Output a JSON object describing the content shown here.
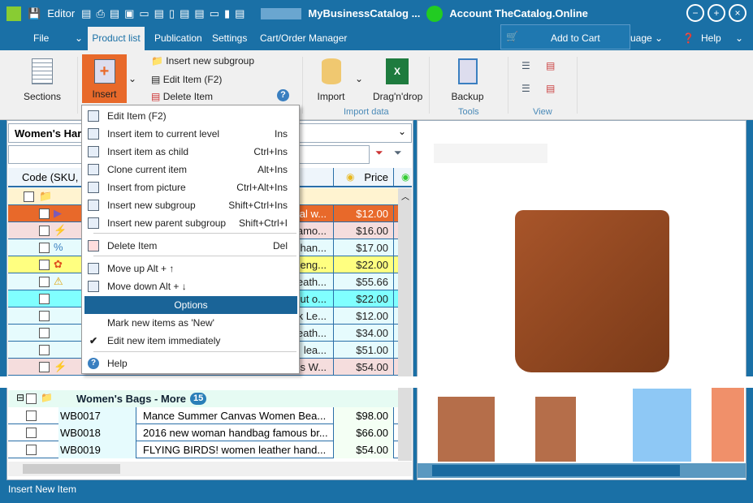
{
  "titlebar": {
    "app_menu": "Editor",
    "catalog": "MyBusinessCatalog ...",
    "account": "Account TheCatalog.Online"
  },
  "tabs": [
    "File",
    "Product list",
    "Publication",
    "Settings",
    "Cart/Order Manager"
  ],
  "tabs_right": {
    "add_to_cart": "Add to Cart",
    "language": "uage",
    "help": "Help"
  },
  "ribbon": {
    "sections": "Sections",
    "insert": "Insert",
    "insert_subgroup": "Insert new subgroup",
    "edit_item": "Edit Item  (F2)",
    "delete_item": "Delete Item",
    "import": "Import",
    "dragdrop": "Drag'n'drop",
    "backup": "Backup",
    "group_import": "Import data",
    "group_tools": "Tools",
    "group_view": "View"
  },
  "left": {
    "combo": "Women's Har",
    "columns": {
      "code": "Code (SKU,",
      "price": "Price"
    },
    "rows": [
      {
        "desc": "al w...",
        "price": "$12.00",
        "bg": "#e8692a",
        "icon": "flag"
      },
      {
        "desc": "amo...",
        "price": "$16.00",
        "bg": "#f5dddd",
        "icon": "lightning"
      },
      {
        "desc": "han...",
        "price": "$17.00",
        "bg": "#e6fbfd",
        "icon": "percent"
      },
      {
        "desc": "seng...",
        "price": "$22.00",
        "bg": "#ffff80",
        "icon": "award"
      },
      {
        "desc": "eath...",
        "price": "$55.66",
        "bg": "#e6fbfd",
        "icon": "warning"
      },
      {
        "code": "WB0",
        "desc": "ut o...",
        "price": "$22.00",
        "bg": "#80ffff"
      },
      {
        "code": "WB0",
        "desc": "k Le...",
        "price": "$12.00",
        "bg": "#e6fbfd"
      },
      {
        "code": "WB0",
        "desc": "eath...",
        "price": "$34.00",
        "bg": "#e6fbfd"
      },
      {
        "code": "WB0",
        "desc": " lea...",
        "price": "$51.00",
        "bg": "#e6fbfd"
      },
      {
        "desc": "s W...",
        "price": "$54.00",
        "bg": "#f5dddd",
        "icon": "lightning"
      }
    ],
    "group2": {
      "title": "Women's Bags - More",
      "count": "15"
    },
    "rows2": [
      {
        "code": "WB0017",
        "desc": "Mance Summer Canvas Women Bea...",
        "price": "$98.00"
      },
      {
        "code": "WB0018",
        "desc": "2016 new woman handbag famous br...",
        "price": "$66.00"
      },
      {
        "code": "WB0019",
        "desc": "FLYING BIRDS! women leather hand...",
        "price": "$54.00"
      }
    ]
  },
  "menu": {
    "items": [
      {
        "label": "Edit Item  (F2)",
        "shortcut": ""
      },
      {
        "label": "Insert item to current level",
        "shortcut": "Ins"
      },
      {
        "label": "Insert item as child",
        "shortcut": "Ctrl+Ins"
      },
      {
        "label": "Clone current item",
        "shortcut": "Alt+Ins"
      },
      {
        "label": "Insert from picture",
        "shortcut": "Ctrl+Alt+Ins"
      },
      {
        "label": "Insert new subgroup",
        "shortcut": "Shift+Ctrl+Ins"
      },
      {
        "label": "Insert new parent subgroup",
        "shortcut": "Shift+Ctrl+I"
      },
      {
        "label": "Delete Item",
        "shortcut": "Del"
      },
      {
        "label": "Move up Alt + ↑",
        "shortcut": ""
      },
      {
        "label": "Move down Alt + ↓",
        "shortcut": ""
      }
    ],
    "options_header": "Options",
    "mark_new": "Mark new items as 'New'",
    "edit_new": "Edit new item immediately",
    "help": "Help"
  },
  "status": "Insert New Item",
  "colors": {
    "accent": "#1a70a6",
    "insert_active": "#e8692a"
  }
}
